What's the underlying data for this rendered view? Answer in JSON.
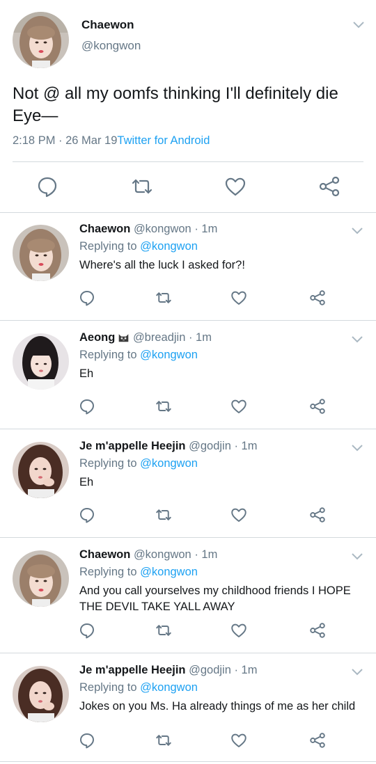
{
  "main_tweet": {
    "name": "Chaewon",
    "handle": "@kongwon",
    "text": "Not @ all my oomfs thinking I'll definitely die Eye—",
    "time": "2:18 PM · 26 Mar 19",
    "source": "Twitter for Android",
    "avatar_icon": "profile-photo",
    "colors": {
      "link": "#1da1f2",
      "secondary": "#657786",
      "divider": "#d3d9dd"
    }
  },
  "replies": [
    {
      "name": "Chaewon",
      "handle": "@kongwon · 1m",
      "replying_label": "Replying to",
      "replying_to": "@kongwon",
      "text": "Where's all the luck I asked for?!"
    },
    {
      "name": "Aeong",
      "name_emoji": "cat-face-emoji",
      "handle": "@breadjin · 1m",
      "replying_label": "Replying to",
      "replying_to": "@kongwon",
      "text": "Eh"
    },
    {
      "name": "Je m'appelle Heejin",
      "handle": "@godjin · 1m",
      "replying_label": "Replying to",
      "replying_to": "@kongwon",
      "text": "Eh"
    },
    {
      "name": "Chaewon",
      "handle": "@kongwon · 1m",
      "replying_label": "Replying to",
      "replying_to": "@kongwon",
      "text": "And you call yourselves my childhood friends I HOPE THE DEVIL TAKE YALL AWAY"
    },
    {
      "name": "Je m'appelle Heejin",
      "handle": "@godjin · 1m",
      "replying_label": "Replying to",
      "replying_to": "@kongwon",
      "text": "Jokes on you Ms. Ha already things of me as her child"
    }
  ],
  "actions": [
    "reply-icon",
    "retweet-icon",
    "like-icon",
    "share-icon"
  ]
}
